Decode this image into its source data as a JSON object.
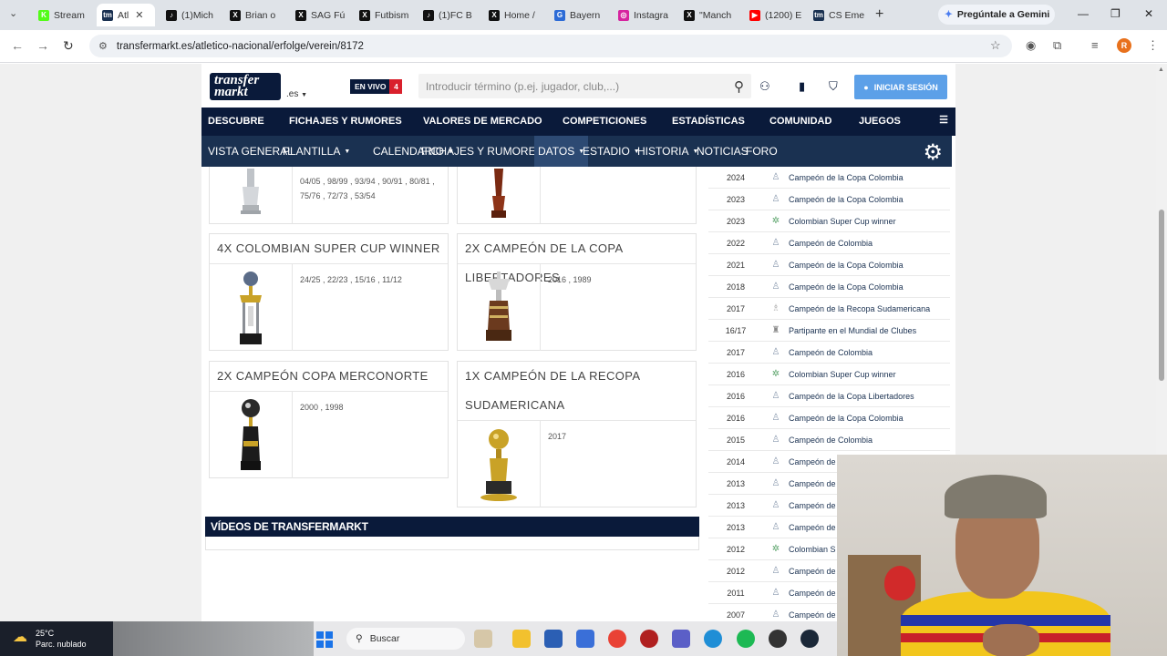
{
  "browser": {
    "tabs": [
      {
        "label": "Stream",
        "color": "#53fc18",
        "glyph": "K"
      },
      {
        "label": "Atl",
        "color": "#1a3151",
        "glyph": "tm",
        "active": true
      },
      {
        "label": "(1)Mich",
        "color": "#111111",
        "glyph": "♪"
      },
      {
        "label": "Brian o",
        "color": "#111111",
        "glyph": "X"
      },
      {
        "label": "SAG Fú",
        "color": "#111111",
        "glyph": "X"
      },
      {
        "label": "Futbism",
        "color": "#111111",
        "glyph": "X"
      },
      {
        "label": "(1)FC B",
        "color": "#111111",
        "glyph": "♪"
      },
      {
        "label": "Home /",
        "color": "#111111",
        "glyph": "X"
      },
      {
        "label": "Bayern",
        "color": "#2c6bd6",
        "glyph": "G"
      },
      {
        "label": "Instagra",
        "color": "#d6249f",
        "glyph": "◎"
      },
      {
        "label": "\"Manch",
        "color": "#111111",
        "glyph": "X"
      },
      {
        "label": "(1200) E",
        "color": "#ff0000",
        "glyph": "▶"
      },
      {
        "label": "CS Eme",
        "color": "#1a3151",
        "glyph": "tm"
      }
    ],
    "gemini_label": "Pregúntale a Gemini",
    "url": "transfermarkt.es/atletico-nacional/erfolge/verein/8172",
    "profile_initial": "R"
  },
  "site": {
    "logo_line1": "transfer",
    "logo_line2": "markt",
    "domain_suffix": ".es",
    "live_label": "EN VIVO",
    "live_count": "4",
    "search_placeholder": "Introducir término (p.ej. jugador, club,...)",
    "login_label": "INICIAR SESIÓN",
    "main_nav": [
      "DESCUBRE",
      "FICHAJES Y RUMORES",
      "VALORES DE MERCADO",
      "COMPETICIONES",
      "ESTADÍSTICAS",
      "COMUNIDAD",
      "JUEGOS"
    ],
    "sub_nav": [
      {
        "label": "VISTA GENERAL",
        "caret": false
      },
      {
        "label": "PLANTILLA",
        "caret": true
      },
      {
        "label": "CALENDARIO",
        "caret": true
      },
      {
        "label": "FICHAJES Y RUMORES",
        "caret": true
      },
      {
        "label": "DATOS",
        "caret": true,
        "active": true
      },
      {
        "label": "ESTADIO",
        "caret": true
      },
      {
        "label": "HISTORIA",
        "caret": true
      },
      {
        "label": "NOTICIAS",
        "caret": false
      },
      {
        "label": "FORO",
        "caret": false
      }
    ]
  },
  "trophies": {
    "partial_left_years": [
      "04/05 , 98/99 , 93/94 , 90/91 , 80/81 ,",
      "75/76 , 72/73 , 53/54"
    ],
    "cards": [
      {
        "title": "4X COLOMBIAN SUPER CUP WINNER",
        "years": "24/25 , 22/23 , 15/16 , 11/12"
      },
      {
        "title": "2X CAMPEÓN DE LA COPA LIBERTADORES",
        "years": "2016 , 1989"
      },
      {
        "title": "2X CAMPEÓN COPA MERCONORTE",
        "years": "2000 , 1998"
      },
      {
        "title_line1": "1X CAMPEÓN DE LA RECOPA",
        "title_line2": "SUDAMERICANA",
        "years": "2017"
      }
    ],
    "videos_heading": "VÍDEOS DE TRANSFERMARKT"
  },
  "honours_list": [
    {
      "year": "2024",
      "title": "Campeón de la Copa Colombia",
      "icon": "cup"
    },
    {
      "year": "2023",
      "title": "Campeón de la Copa Colombia",
      "icon": "cup"
    },
    {
      "year": "2023",
      "title": "Colombian Super Cup winner",
      "icon": "super"
    },
    {
      "year": "2022",
      "title": "Campeón de Colombia",
      "icon": "cup"
    },
    {
      "year": "2021",
      "title": "Campeón de la Copa Colombia",
      "icon": "cup"
    },
    {
      "year": "2018",
      "title": "Campeón de la Copa Colombia",
      "icon": "cup"
    },
    {
      "year": "2017",
      "title": "Campeón de la Recopa Sudamericana",
      "icon": "recopa"
    },
    {
      "year": "16/17",
      "title": "Partipante en el Mundial de Clubes",
      "icon": "mundial"
    },
    {
      "year": "2017",
      "title": "Campeón de Colombia",
      "icon": "cup"
    },
    {
      "year": "2016",
      "title": "Colombian Super Cup winner",
      "icon": "super"
    },
    {
      "year": "2016",
      "title": "Campeón de la Copa Libertadores",
      "icon": "cup"
    },
    {
      "year": "2016",
      "title": "Campeón de la Copa Colombia",
      "icon": "cup"
    },
    {
      "year": "2015",
      "title": "Campeón de Colombia",
      "icon": "cup"
    },
    {
      "year": "2014",
      "title": "Campeón de Colombia",
      "icon": "cup"
    },
    {
      "year": "2013",
      "title": "Campeón de",
      "icon": "cup"
    },
    {
      "year": "2013",
      "title": "Campeón de",
      "icon": "cup"
    },
    {
      "year": "2013",
      "title": "Campeón de",
      "icon": "cup"
    },
    {
      "year": "2012",
      "title": "Colombian S",
      "icon": "super"
    },
    {
      "year": "2012",
      "title": "Campeón de",
      "icon": "cup"
    },
    {
      "year": "2011",
      "title": "Campeón de",
      "icon": "cup"
    },
    {
      "year": "2007",
      "title": "Campeón de",
      "icon": "cup"
    }
  ],
  "taskbar": {
    "temperature": "25°C",
    "weather": "Parc. nublado",
    "search_label": "Buscar"
  },
  "colors": {
    "tm_navy": "#0a1a3a",
    "tm_subnav": "#1a3151",
    "login_blue": "#5ca0e8",
    "live_red": "#d9202c"
  }
}
